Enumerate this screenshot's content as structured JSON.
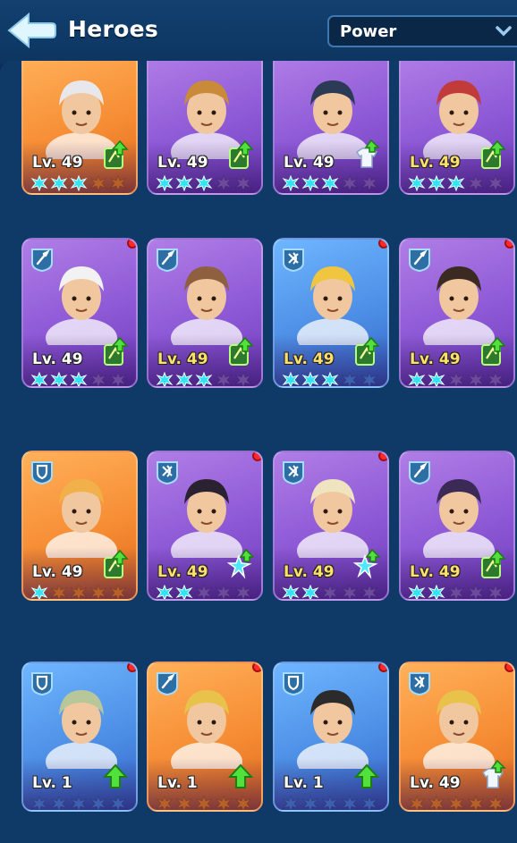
{
  "header": {
    "title": "Heroes",
    "sort_label": "Power"
  },
  "colors": {
    "purple": "#8d58d6",
    "orange": "#f68d34",
    "blue": "#4d8fe6",
    "star_on": "#33e3f2",
    "star_off": "#6d4a9e",
    "red_dot": "#ff2a2a",
    "gold_text": "#ffe06a"
  },
  "cards": [
    {
      "level": "Lv. 49",
      "bg": "orange",
      "badge": "",
      "stars_on": 3,
      "upgrade": "skillbook-icon",
      "dot": false,
      "gold": false
    },
    {
      "level": "Lv. 49",
      "bg": "purple",
      "badge": "",
      "stars_on": 3,
      "upgrade": "skillbook-icon",
      "dot": false,
      "gold": false
    },
    {
      "level": "Lv. 49",
      "bg": "purple",
      "badge": "",
      "stars_on": 3,
      "upgrade": "gear-shirt-icon",
      "dot": false,
      "gold": false
    },
    {
      "level": "Lv. 49",
      "bg": "purple",
      "badge": "",
      "stars_on": 3,
      "upgrade": "skillbook-icon",
      "dot": false,
      "gold": true
    },
    {
      "level": "Lv. 49",
      "bg": "purple",
      "badge": "lance-class-icon",
      "stars_on": 3,
      "upgrade": "skillbook-icon",
      "dot": true,
      "gold": false
    },
    {
      "level": "Lv. 49",
      "bg": "purple",
      "badge": "lance-class-icon",
      "stars_on": 3,
      "upgrade": "skillbook-icon",
      "dot": false,
      "gold": true
    },
    {
      "level": "Lv. 49",
      "bg": "blue",
      "badge": "marksman-class-icon",
      "stars_on": 3,
      "upgrade": "skillbook-icon",
      "dot": true,
      "gold": true
    },
    {
      "level": "Lv. 49",
      "bg": "purple",
      "badge": "lance-class-icon",
      "stars_on": 2,
      "upgrade": "skillbook-icon",
      "dot": true,
      "gold": true
    },
    {
      "level": "Lv. 49",
      "bg": "orange",
      "badge": "shield-class-icon",
      "stars_on": 1,
      "upgrade": "skillbook-icon",
      "dot": false,
      "gold": false
    },
    {
      "level": "Lv. 49",
      "bg": "purple",
      "badge": "marksman-class-icon",
      "stars_on": 2,
      "upgrade": "star-shard-icon",
      "dot": true,
      "gold": true
    },
    {
      "level": "Lv. 49",
      "bg": "purple",
      "badge": "marksman-class-icon",
      "stars_on": 2,
      "upgrade": "star-shard-icon",
      "dot": true,
      "gold": true
    },
    {
      "level": "Lv. 49",
      "bg": "purple",
      "badge": "lance-class-icon",
      "stars_on": 2,
      "upgrade": "skillbook-icon",
      "dot": false,
      "gold": true
    },
    {
      "level": "Lv. 1",
      "bg": "blue",
      "badge": "shield-class-icon",
      "stars_on": 0,
      "upgrade": "arrow-up-icon",
      "dot": true,
      "gold": false
    },
    {
      "level": "Lv. 1",
      "bg": "orange",
      "badge": "lance-class-icon",
      "stars_on": 0,
      "upgrade": "arrow-up-icon",
      "dot": true,
      "gold": false
    },
    {
      "level": "Lv. 1",
      "bg": "blue",
      "badge": "shield-class-icon",
      "stars_on": 0,
      "upgrade": "arrow-up-icon",
      "dot": true,
      "gold": false
    },
    {
      "level": "Lv. 49",
      "bg": "orange",
      "badge": "marksman-class-icon",
      "stars_on": 0,
      "upgrade": "gear-shirt-icon",
      "dot": true,
      "gold": false
    }
  ]
}
